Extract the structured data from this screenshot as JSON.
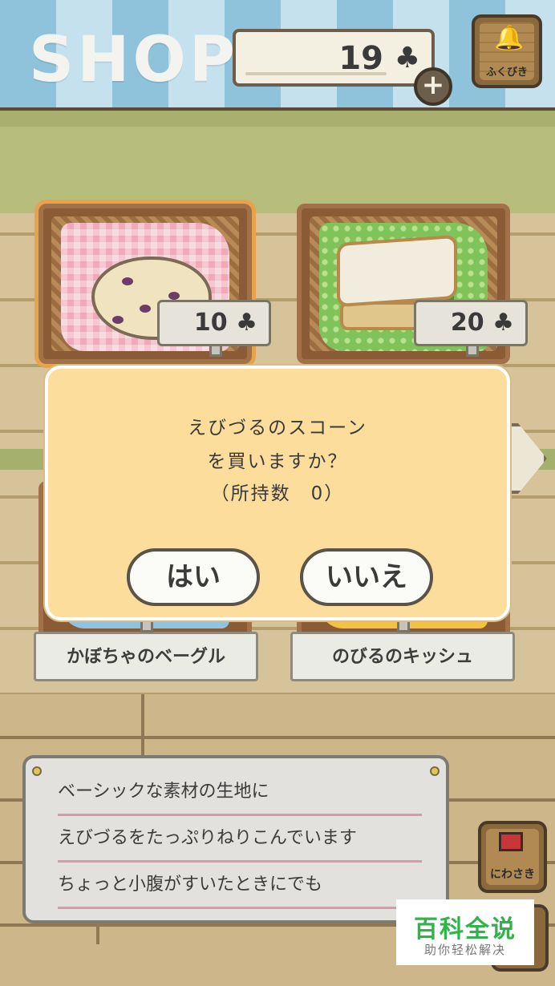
{
  "header": {
    "shop_title": "SHOP",
    "clover_count": "19",
    "clover_icon": "♣",
    "plus_label": "+",
    "fukubiki_label": "ふくびき",
    "fukubiki_icon": "bell-icon"
  },
  "products": [
    {
      "name": "",
      "price": "10",
      "price_icon": "♣",
      "cloth_color": "#f0a9b9",
      "item": "scone"
    },
    {
      "name": "",
      "price": "20",
      "price_icon": "♣",
      "cloth_color": "#7fc35a",
      "item": "sandwich"
    },
    {
      "name": "かぼちゃのベーグル",
      "cloth_color": "#8fc3e4"
    },
    {
      "name": "のびるのキッシュ",
      "cloth_color": "#f4c142"
    }
  ],
  "dialog": {
    "line1": "えびづるのスコーン",
    "line2": "を買いますか？",
    "line3": "（所持数　0）",
    "yes_label": "はい",
    "no_label": "いいえ"
  },
  "description": {
    "lines": [
      "ベーシックな素材の生地に",
      "えびづるをたっぷりねりこんでいます",
      "ちょっと小腹がすいたときにでも"
    ]
  },
  "side_buttons": {
    "niwasaki_label": "にわさき"
  },
  "watermark": {
    "top": "百科全说",
    "bottom": "助你轻松解决"
  },
  "colors": {
    "dialog_bg": "#fcdd9b",
    "awning_blue": "#8fc3dc",
    "selected_outline": "#e8a24b"
  }
}
